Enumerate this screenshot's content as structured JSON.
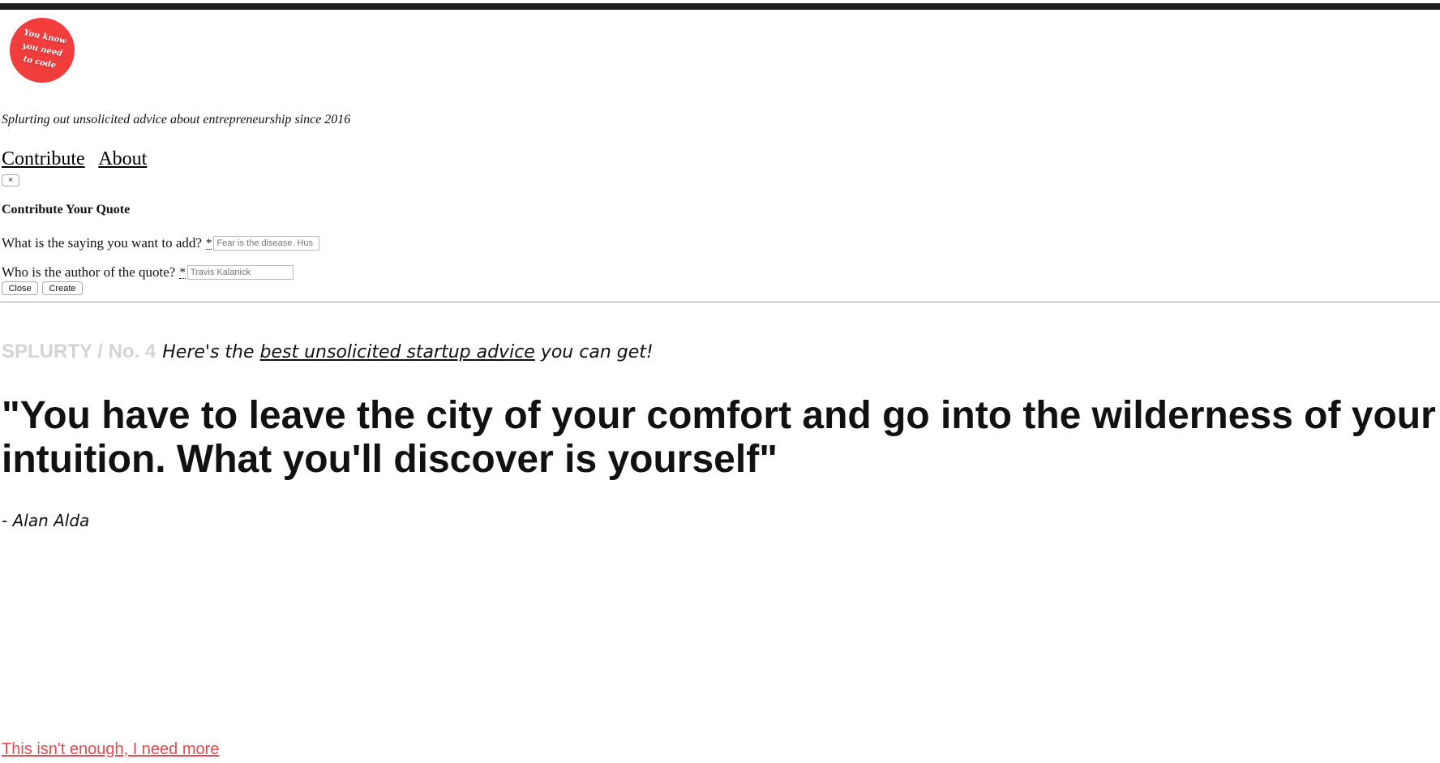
{
  "header": {
    "logo_lines": [
      "You know",
      "you need",
      "to code"
    ],
    "tagline": "Splurting out unsolicited advice about entrepreneurship since 2016",
    "nav": [
      "Contribute",
      "About"
    ]
  },
  "modal": {
    "close_symbol": "×",
    "title": "Contribute Your Quote",
    "saying_label": "What is the saying you want to add?",
    "saying_required": "*",
    "saying_placeholder": "Fear is the disease. Hus",
    "author_label": "Who is the author of the quote?",
    "author_required": "*",
    "author_placeholder": "Travis Kalanick",
    "close_label": "Close",
    "create_label": "Create"
  },
  "main": {
    "brand": "SPLURTY / No. 4",
    "intro_before": "Here's the ",
    "intro_link": "best unsolicited startup advice",
    "intro_after": " you can get!",
    "quote": "\"You have to leave the city of your comfort and go into the wilderness of your intuition. What you'll discover is yourself\"",
    "author": "- Alan Alda",
    "more_link": "This isn't enough, I need more"
  },
  "colors": {
    "logo": "#f23d3d",
    "brand_gray": "#d4d4d4",
    "more_link": "#e8474c",
    "topbar": "#1e1e1e"
  }
}
